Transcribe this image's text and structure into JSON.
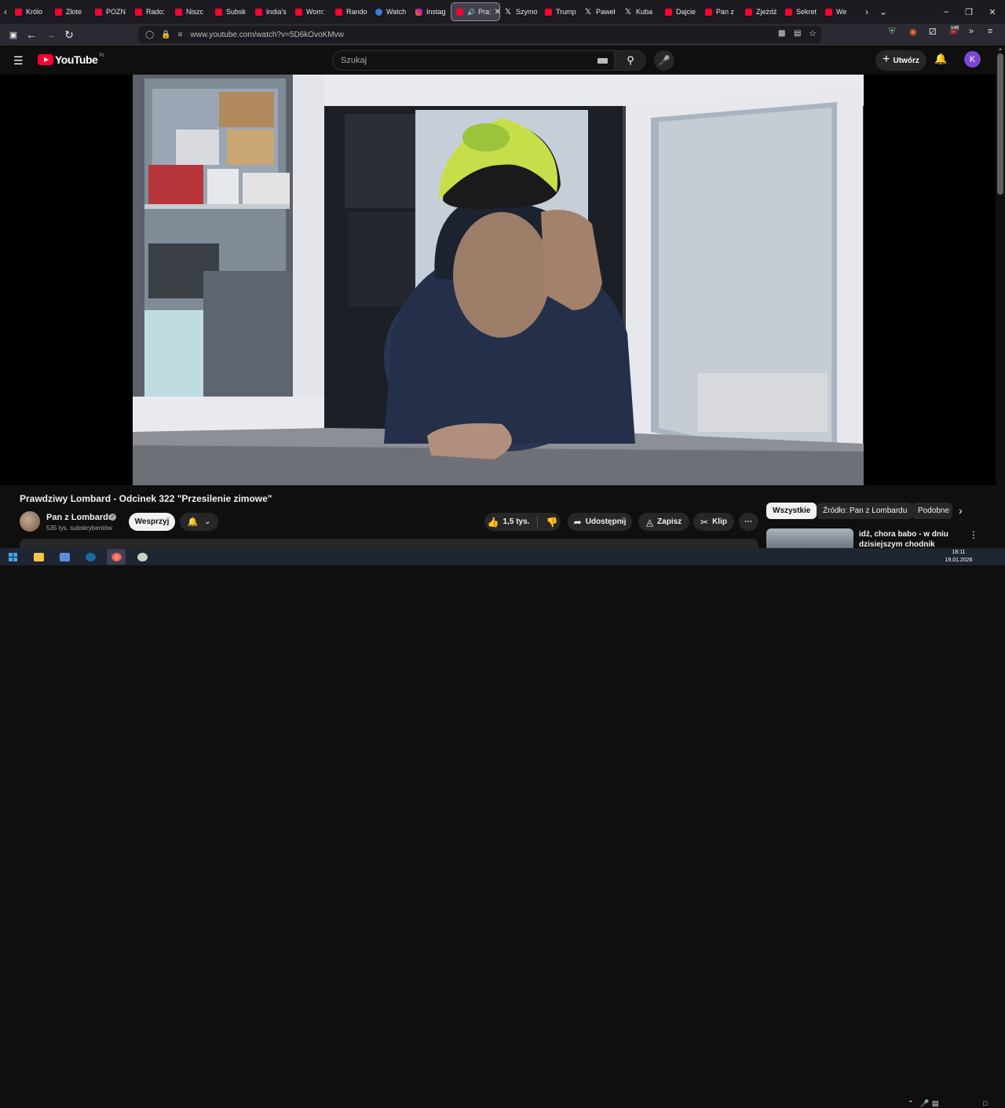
{
  "browser": {
    "tabs": [
      {
        "label": "Królo",
        "icon": "youtube-icon"
      },
      {
        "label": "Złote",
        "icon": "youtube-icon"
      },
      {
        "label": "POZN",
        "icon": "youtube-icon"
      },
      {
        "label": "Rado:",
        "icon": "youtube-icon"
      },
      {
        "label": "Niszc",
        "icon": "youtube-icon"
      },
      {
        "label": "Subsk",
        "icon": "youtube-icon"
      },
      {
        "label": "India's",
        "icon": "youtube-icon"
      },
      {
        "label": "Wom:",
        "icon": "youtube-icon"
      },
      {
        "label": "Rando",
        "icon": "youtube-icon"
      },
      {
        "label": "Watch",
        "icon": "msn-icon"
      },
      {
        "label": "Instag",
        "icon": "instagram-icon"
      },
      {
        "label": "Pra:",
        "icon": "youtube-icon",
        "active": true
      },
      {
        "label": "Szymo",
        "icon": "x-icon"
      },
      {
        "label": "Trump",
        "icon": "youtube-icon"
      },
      {
        "label": "Paweł",
        "icon": "x-icon"
      },
      {
        "label": "Kuba",
        "icon": "x-icon"
      },
      {
        "label": "Dajcie",
        "icon": "youtube-icon"
      },
      {
        "label": "Pan z",
        "icon": "youtube-icon"
      },
      {
        "label": "Zjeżdż",
        "icon": "youtube-icon"
      },
      {
        "label": "Sekret",
        "icon": "youtube-icon"
      },
      {
        "label": "We",
        "icon": "youtube-icon"
      }
    ],
    "url": "www.youtube.com/watch?v=5D6kOvoKMvw",
    "extension_badge": "148"
  },
  "youtube": {
    "logo_text": "YouTube",
    "logo_country": "PL",
    "search_placeholder": "Szukaj",
    "create_label": "Utwórz",
    "avatar_letter": "K"
  },
  "video": {
    "title": "Prawdziwy Lombard - Odcinek 322 \"Przesilenie zimowe\"",
    "channel": "Pan z Lombardu",
    "subscribers": "535 tys. subskrybentów",
    "support_label": "Wesprzyj",
    "likes": "1,5 tys.",
    "share_label": "Udostępnij",
    "save_label": "Zapisz",
    "clip_label": "Klip"
  },
  "chips": [
    "Wszystkie",
    "Źródło: Pan z Lombardu",
    "Podobne"
  ],
  "recommendation": {
    "title": "idź, chora babo - w dniu dzisiejszym chodnik pieszym"
  },
  "taskbar": {
    "time": "18:11",
    "date": "19.01.2026"
  }
}
